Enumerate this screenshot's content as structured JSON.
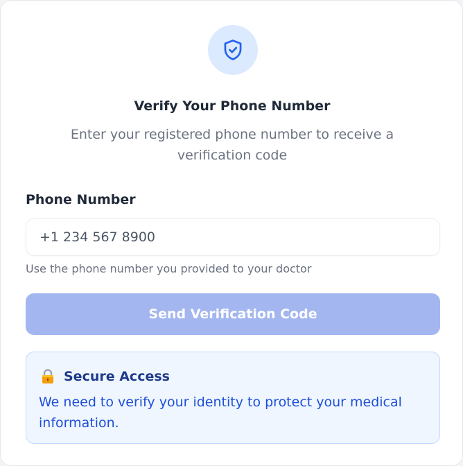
{
  "header": {
    "icon": "shield-check-icon",
    "title": "Verify Your Phone Number",
    "subtitle": "Enter your registered phone number to receive a verification code"
  },
  "form": {
    "phone_label": "Phone Number",
    "phone_placeholder": "+1 234 567 8900",
    "phone_value": "",
    "hint": "Use the phone number you provided to your doctor",
    "submit_label": "Send Verification Code",
    "submit_enabled": false
  },
  "info": {
    "icon": "lock-icon",
    "title": "Secure Access",
    "text": "We need to verify your identity to protect your medical information."
  },
  "colors": {
    "accent": "#2563eb",
    "icon_circle": "#dbeafe",
    "button_disabled": "#a3b6ef",
    "info_bg": "#eff6ff",
    "info_border": "#bfdbfe",
    "info_title": "#1e3a8a",
    "info_text": "#1d4ed8"
  }
}
